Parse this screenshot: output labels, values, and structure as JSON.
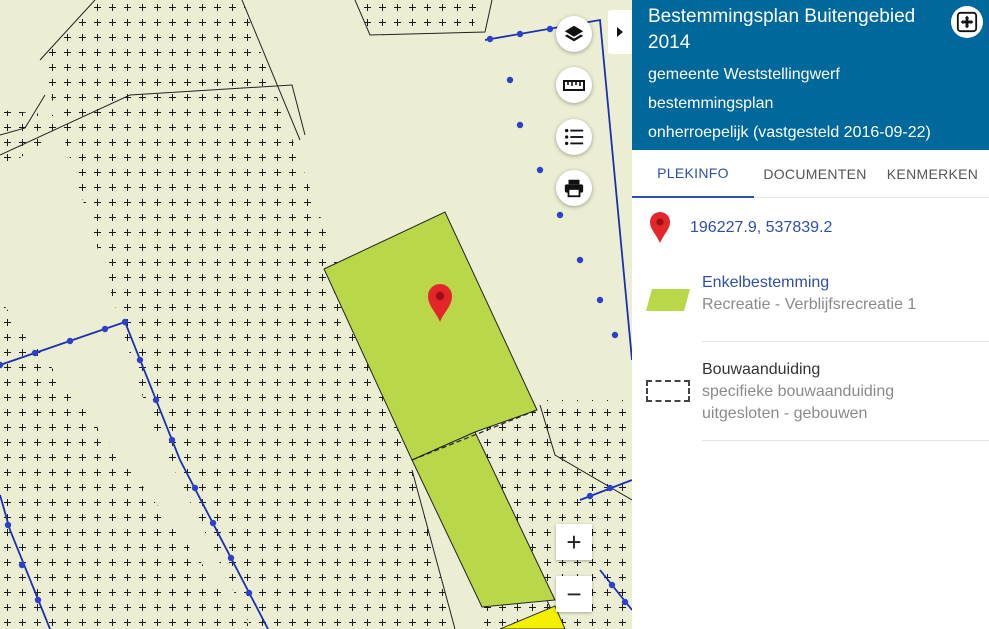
{
  "colors": {
    "header_bg": "#01689b",
    "accent": "#2d4fa8",
    "map_background": "#eceed4",
    "recreatie_fill": "#b9d748",
    "plan_boundary": "#1c2fb0",
    "marker_red": "#e4262b",
    "yellow_area": "#f5f000"
  },
  "map": {
    "icons": {
      "layers": "layers-icon",
      "measure": "ruler-icon",
      "legend": "list-icon",
      "print": "printer-icon",
      "marker": "map-pin-icon"
    },
    "zoom_in_label": "+",
    "zoom_out_label": "−"
  },
  "panel": {
    "title": "Bestemmingsplan Buitengebied 2014",
    "municipality": "gemeente Weststellingwerf",
    "plan_type": "bestemmingsplan",
    "status": "onherroepelijk (vastgesteld 2016-09-22)",
    "expand_icon": "expand-icon",
    "tabs": [
      {
        "label": "PLEKINFO",
        "active": true
      },
      {
        "label": "DOCUMENTEN",
        "active": false
      },
      {
        "label": "KENMERKEN",
        "active": false
      }
    ],
    "coordinates": "196227.9, 537839.2",
    "items": [
      {
        "title": "Enkelbestemming",
        "lines": [
          "Recreatie - Verblijfsrecreatie 1"
        ]
      },
      {
        "title": "Bouwaanduiding",
        "lines": [
          "specifieke bouwaanduiding",
          "uitgesloten - gebouwen"
        ]
      }
    ]
  }
}
